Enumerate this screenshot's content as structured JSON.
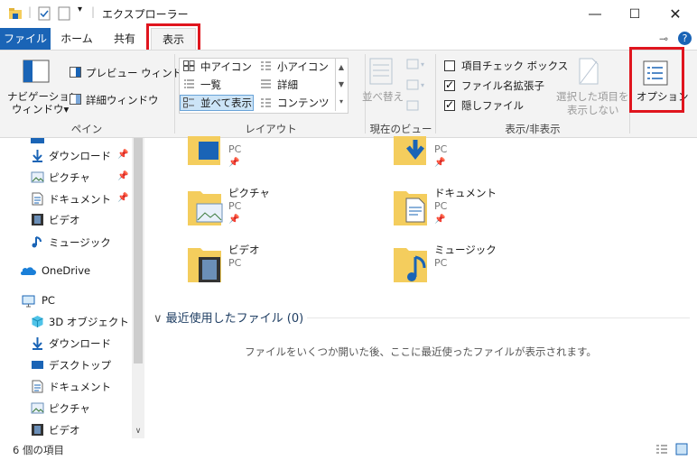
{
  "window": {
    "title": "エクスプローラー"
  },
  "tabs": {
    "file": "ファイル",
    "home": "ホーム",
    "share": "共有",
    "view": "表示"
  },
  "ribbon": {
    "panes": {
      "label": "ペイン",
      "nav_pane": "ナビゲーション\nウィンドウ",
      "nav_pane_l1": "ナビゲーション",
      "nav_pane_l2": "ウィンドウ▾",
      "preview": "プレビュー ウィンドウ",
      "details": "詳細ウィンドウ"
    },
    "layout": {
      "label": "レイアウト",
      "items": [
        "中アイコン",
        "小アイコン",
        "一覧",
        "詳細",
        "並べて表示",
        "コンテンツ"
      ]
    },
    "current_view": {
      "label": "現在のビュー",
      "sort": "並べ替え"
    },
    "show_hide": {
      "label": "表示/非表示",
      "item_checkbox": "項目チェック ボックス",
      "item_checkbox_checked": false,
      "extensions": "ファイル名拡張子",
      "extensions_checked": true,
      "hidden": "隠しファイル",
      "hidden_checked": true,
      "hide_selected_l1": "選択した項目を",
      "hide_selected_l2": "表示しない"
    },
    "options": "オプション"
  },
  "nav": {
    "items": [
      {
        "label": "ダウンロード",
        "icon": "download-icon",
        "pinned": true
      },
      {
        "label": "ピクチャ",
        "icon": "pictures-icon",
        "pinned": true
      },
      {
        "label": "ドキュメント",
        "icon": "documents-icon",
        "pinned": true
      },
      {
        "label": "ビデオ",
        "icon": "video-icon",
        "pinned": false
      },
      {
        "label": "ミュージック",
        "icon": "music-icon",
        "pinned": false
      },
      {
        "label": "OneDrive",
        "icon": "cloud-icon",
        "pinned": false
      },
      {
        "label": "PC",
        "icon": "pc-icon",
        "pinned": false
      },
      {
        "label": "3D オブジェクト",
        "icon": "3d-objects-icon",
        "pinned": false
      },
      {
        "label": "ダウンロード",
        "icon": "download-icon",
        "pinned": false
      },
      {
        "label": "デスクトップ",
        "icon": "desktop-icon",
        "pinned": false
      },
      {
        "label": "ドキュメント",
        "icon": "documents-icon",
        "pinned": false
      },
      {
        "label": "ピクチャ",
        "icon": "pictures-icon",
        "pinned": false
      },
      {
        "label": "ビデオ",
        "icon": "video-icon",
        "pinned": false
      }
    ]
  },
  "folders": [
    {
      "name": "ピクチャ",
      "location": "PC",
      "pinned": true
    },
    {
      "name": "ドキュメント",
      "location": "PC",
      "pinned": true
    },
    {
      "name": "ビデオ",
      "location": "PC",
      "pinned": false
    },
    {
      "name": "ミュージック",
      "location": "PC",
      "pinned": false
    },
    {
      "name": "",
      "location": "PC",
      "pinned": true
    },
    {
      "name": "",
      "location": "PC",
      "pinned": true
    }
  ],
  "recent": {
    "header": "最近使用したファイル (0)",
    "message": "ファイルをいくつか開いた後、ここに最近使ったファイルが表示されます。"
  },
  "status": {
    "count": "6 個の項目"
  },
  "colors": {
    "accent": "#1a64b6",
    "highlight": "#e0151e",
    "folder": "#f4cd5d"
  }
}
